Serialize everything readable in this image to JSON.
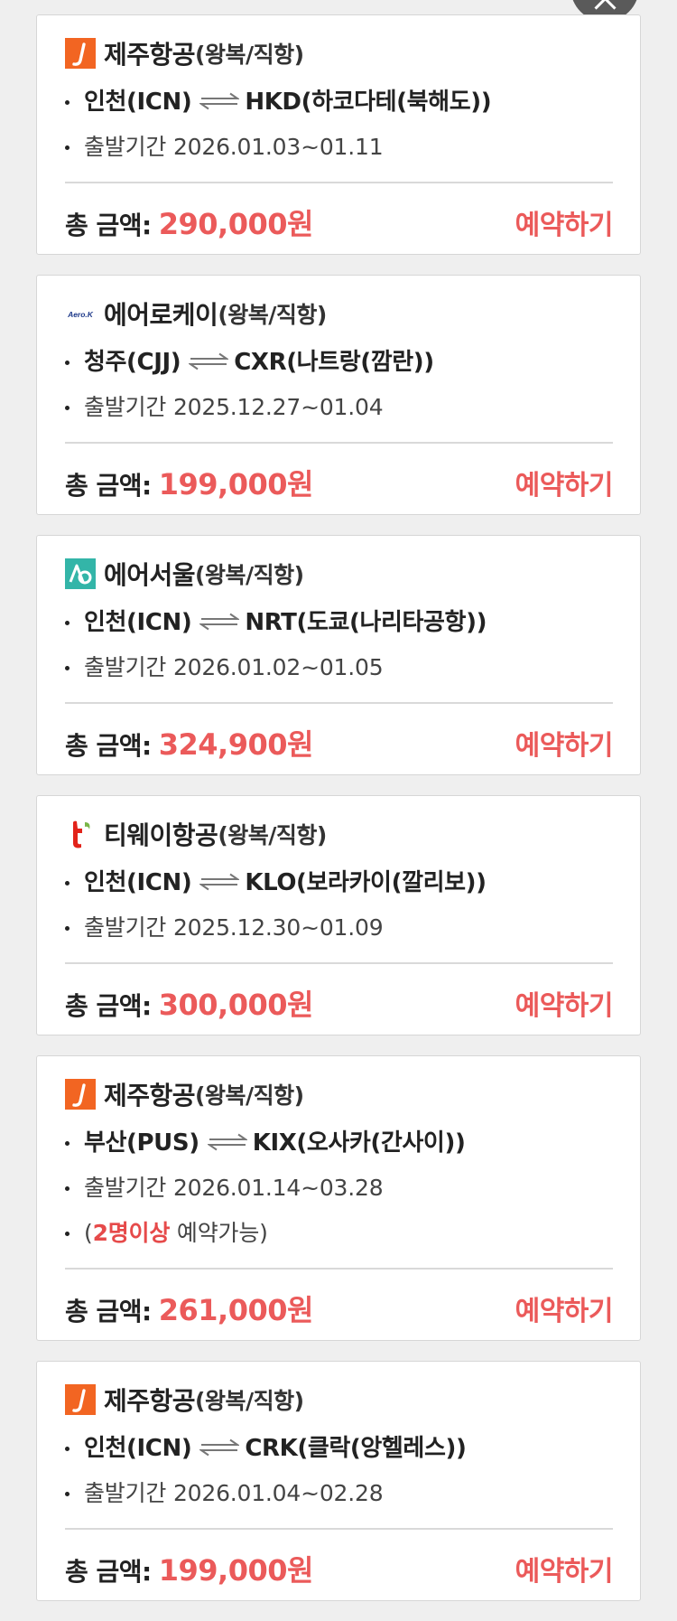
{
  "ui": {
    "total_label": "총 금액:",
    "book_label": "예약하기",
    "colors": {
      "price": "#eb5a5a",
      "highlight": "#e64a4a",
      "jeju_orange": "#f26522",
      "airseoul_teal": "#33b5a8",
      "tway_red": "#e2231a"
    }
  },
  "icons": {
    "scroll_top": "chevron-up-icon",
    "route": "round-trip-arrows-icon"
  },
  "cards": [
    {
      "logo": "jeju-air-logo",
      "airline": "제주항공",
      "trip_type": "(왕복/직항)",
      "route": {
        "from": "인천(ICN)",
        "to": "HKD(하코다테(북해도))"
      },
      "period": "출발기간 2026.01.03~01.11",
      "price": "290,000원"
    },
    {
      "logo": "aerok-logo",
      "logo_text": "Aero.K",
      "airline": "에어로케이",
      "trip_type": "(왕복/직항)",
      "route": {
        "from": "청주(CJJ)",
        "to": "CXR(나트랑(깜란))"
      },
      "period": "출발기간 2025.12.27~01.04",
      "price": "199,000원"
    },
    {
      "logo": "air-seoul-logo",
      "airline": "에어서울",
      "trip_type": "(왕복/직항)",
      "route": {
        "from": "인천(ICN)",
        "to": "NRT(도쿄(나리타공항))"
      },
      "period": "출발기간 2026.01.02~01.05",
      "price": "324,900원"
    },
    {
      "logo": "tway-logo",
      "airline": "티웨이항공",
      "trip_type": "(왕복/직항)",
      "route": {
        "from": "인천(ICN)",
        "to": "KLO(보라카이(깔리보))"
      },
      "period": "출발기간 2025.12.30~01.09",
      "price": "300,000원"
    },
    {
      "logo": "jeju-air-logo",
      "airline": "제주항공",
      "trip_type": "(왕복/직항)",
      "route": {
        "from": "부산(PUS)",
        "to": "KIX(오사카(간사이))"
      },
      "period": "출발기간 2026.01.14~03.28",
      "note": {
        "open": "(",
        "highlight": "2명이상",
        "rest": " 예약가능)"
      },
      "price": "261,000원"
    },
    {
      "logo": "jeju-air-logo",
      "airline": "제주항공",
      "trip_type": "(왕복/직항)",
      "route": {
        "from": "인천(ICN)",
        "to": "CRK(클락(앙헬레스))"
      },
      "period": "출발기간 2026.01.04~02.28",
      "price": "199,000원"
    }
  ]
}
